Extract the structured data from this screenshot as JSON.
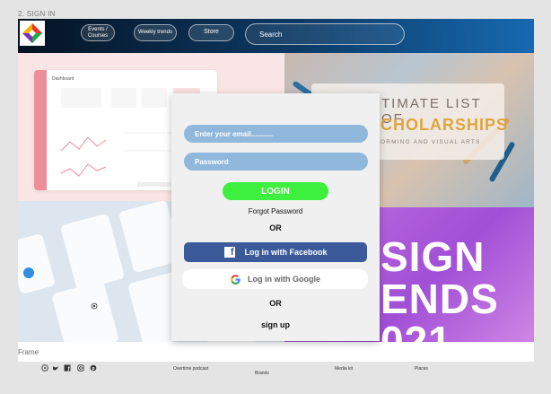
{
  "canvas_label": "2. SIGN IN",
  "frame_label": "Frame",
  "header": {
    "nav": [
      {
        "label": "Events / Courses"
      },
      {
        "label": "Weekly trends"
      },
      {
        "label": "Store"
      }
    ],
    "search_placeholder": "Search"
  },
  "background": {
    "dashboard_title": "Dashboard",
    "scholarships": {
      "line1": "TIMATE LIST OF",
      "line2": "CHOLARSHIPS",
      "line3": "ORMING AND VISUAL ARTS"
    },
    "design_trends": {
      "line1": "SIGN",
      "line2": "ENDS",
      "line3": "021"
    }
  },
  "modal": {
    "email_placeholder": "Enter your email...........",
    "password_placeholder": "Password",
    "login_label": "LOGIN",
    "forgot_password": "Forgot Password",
    "or_1": "OR",
    "facebook_label": "Log in with Facebook",
    "google_label": "Log in with Google",
    "or_2": "OR",
    "signup_label": "sign up"
  },
  "footer": {
    "links": [
      "Overtime podcast",
      "Brands",
      "Media kit",
      "Places"
    ],
    "social_icons": [
      "pinterest-icon",
      "twitter-icon",
      "facebook-icon",
      "instagram-icon",
      "pinterest-icon"
    ]
  },
  "colors": {
    "header_start": "#041222",
    "header_end": "#1769b1",
    "field_bg": "#8fb8dc",
    "login_green": "#3df03d",
    "facebook_blue": "#3a5a9a",
    "modal_bg": "#f0f0f0"
  }
}
